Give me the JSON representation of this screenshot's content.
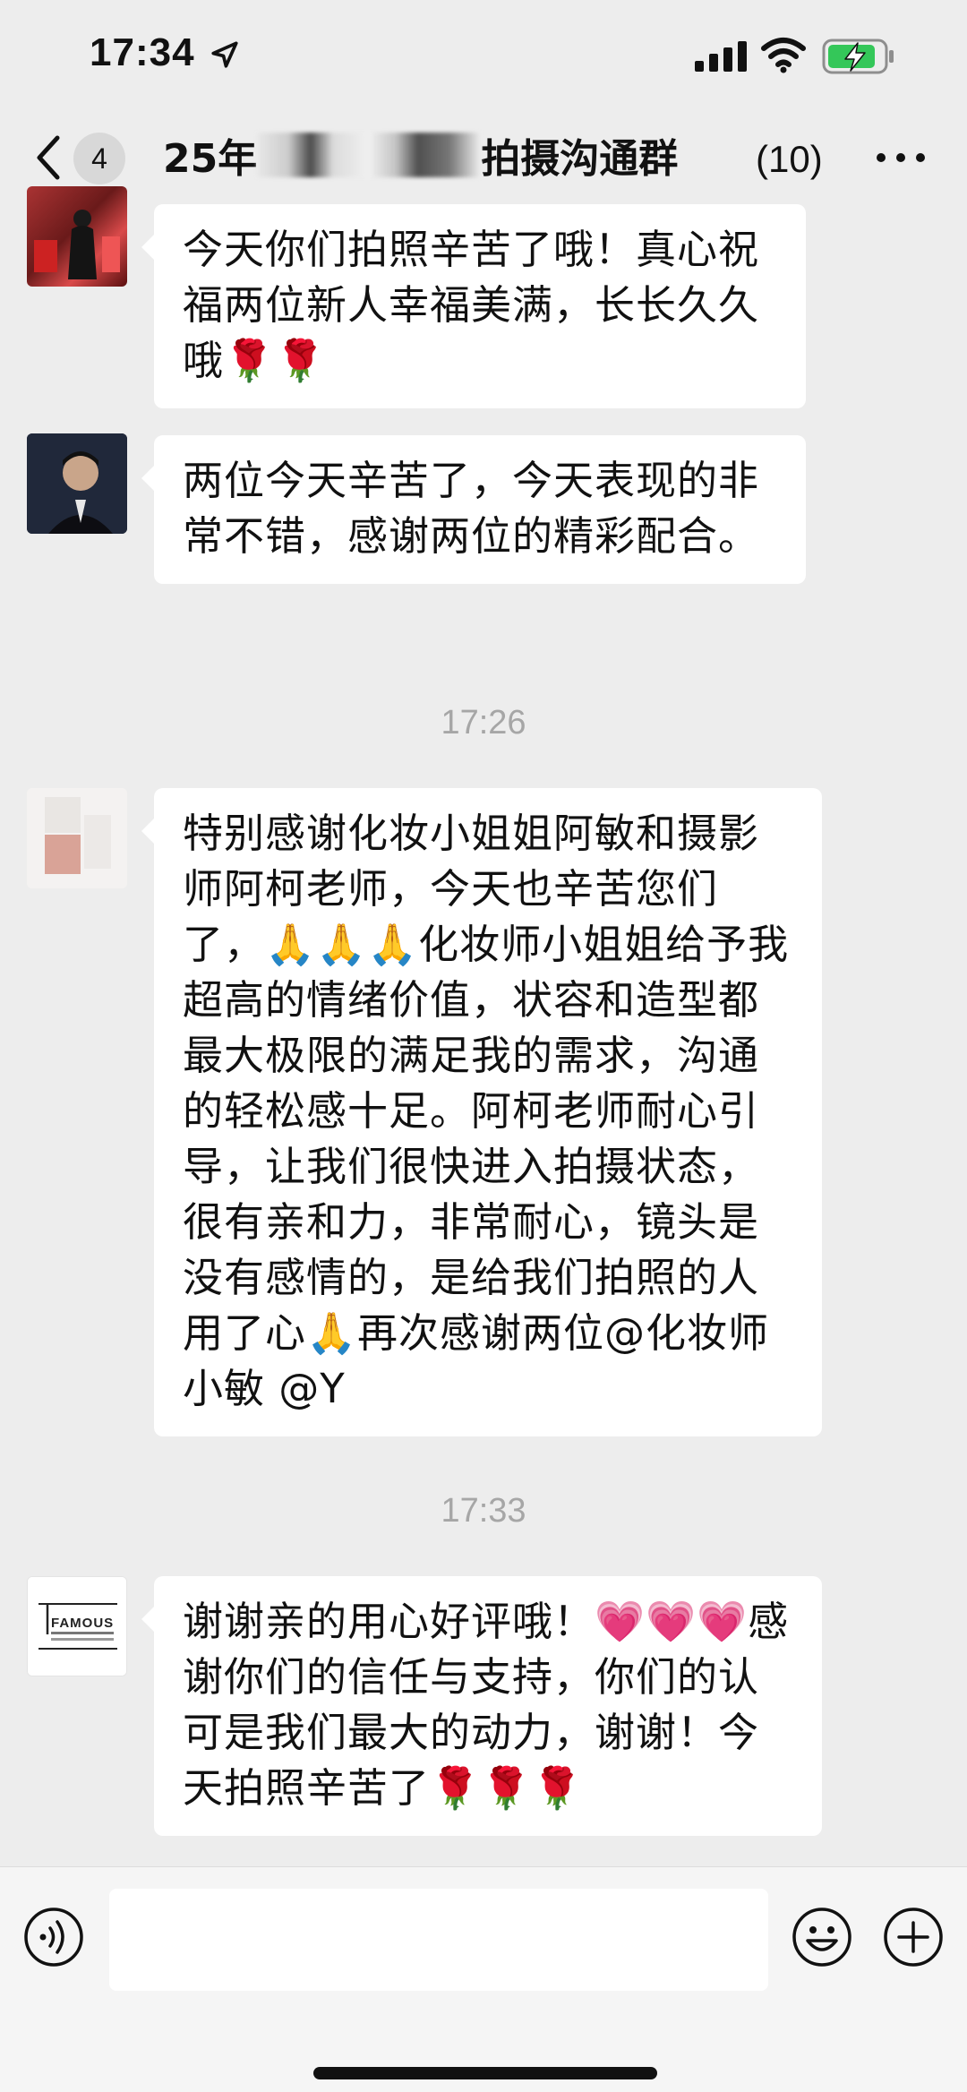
{
  "status_bar": {
    "time": "17:34"
  },
  "nav": {
    "unread_count": "4",
    "title_prefix": "25年",
    "title_suffix": "拍摄沟通群",
    "member_count": "(10)"
  },
  "messages": [
    {
      "text": "今天你们拍照辛苦了哦！真心祝福两位新人幸福美满，长长久久哦🌹🌹"
    },
    {
      "text": "两位今天辛苦了，今天表现的非常不错，感谢两位的精彩配合。"
    },
    {
      "timestamp": "17:26"
    },
    {
      "text": "特别感谢化妆小姐姐阿敏和摄影师阿柯老师，今天也辛苦您们了，🙏🙏🙏化妆师小姐姐给予我超高的情绪价值，状容和造型都最大极限的满足我的需求，沟通的轻松感十足。阿柯老师耐心引导，让我们很快进入拍摄状态，很有亲和力，非常耐心，镜头是没有感情的，是给我们拍照的人用了心🙏再次感谢两位@化妆师小敏 @Y"
    },
    {
      "timestamp": "17:33"
    },
    {
      "text": "谢谢亲的用心好评哦！💗💗💗感谢你们的信任与支持，你们的认可是我们最大的动力，谢谢！今天拍照辛苦了🌹🌹🌹"
    }
  ],
  "avatar_logo": {
    "brand": "FAMOUS"
  },
  "colors": {
    "background": "#ededed",
    "bubble": "#ffffff",
    "timestamp": "#a6a6a6",
    "battery": "#34c759"
  },
  "icons": [
    "location-arrow-icon",
    "signal-icon",
    "wifi-icon",
    "battery-charging-icon",
    "back-icon",
    "more-icon",
    "voice-icon",
    "emoji-icon",
    "plus-icon"
  ]
}
